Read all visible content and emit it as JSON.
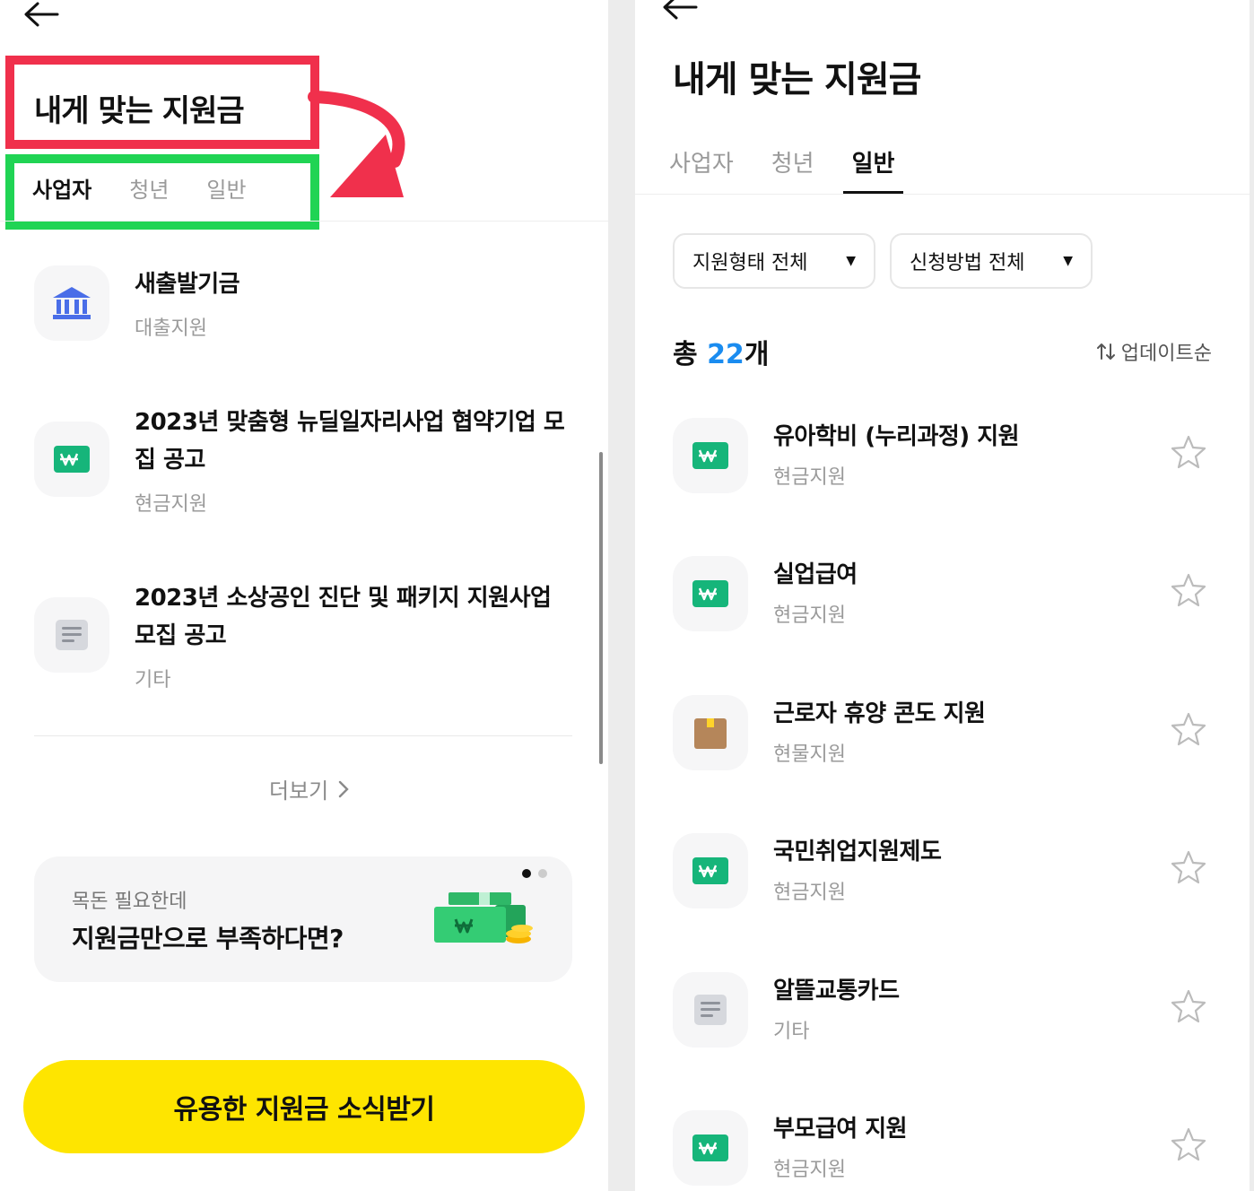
{
  "left": {
    "title": "내게 맞는 지원금",
    "tabs": [
      "사업자",
      "청년",
      "일반"
    ],
    "items": [
      {
        "title": "새출발기금",
        "category": "대출지원",
        "icon": "bank-icon"
      },
      {
        "title": "2023년 맞춤형 뉴딜일자리사업 협약기업 모집 공고",
        "category": "현금지원",
        "icon": "won-icon"
      },
      {
        "title": "2023년 소상공인 진단 및 패키지 지원사업 모집 공고",
        "category": "기타",
        "icon": "document-icon"
      }
    ],
    "more": "더보기",
    "banner": {
      "sub": "목돈 필요한데",
      "main": "지원금만으로 부족하다면?"
    },
    "cta": "유용한 지원금 소식받기"
  },
  "right": {
    "title": "내게 맞는 지원금",
    "tabs": [
      "사업자",
      "청년",
      "일반"
    ],
    "filters": [
      "지원형태 전체",
      "신청방법 전체"
    ],
    "count_prefix": "총",
    "count_num": "22",
    "count_suffix": "개",
    "sort": "업데이트순",
    "items": [
      {
        "title": "유아학비 (누리과정) 지원",
        "category": "현금지원",
        "icon": "won-icon"
      },
      {
        "title": "실업급여",
        "category": "현금지원",
        "icon": "won-icon"
      },
      {
        "title": "근로자 휴양 콘도 지원",
        "category": "현물지원",
        "icon": "box-icon"
      },
      {
        "title": "국민취업지원제도",
        "category": "현금지원",
        "icon": "won-icon"
      },
      {
        "title": "알뜰교통카드",
        "category": "기타",
        "icon": "document-icon"
      },
      {
        "title": "부모급여 지원",
        "category": "현금지원",
        "icon": "won-icon"
      }
    ]
  },
  "colors": {
    "accent_yellow": "#fee500",
    "won_green": "#16b57a",
    "annotation_red": "#f0304c",
    "annotation_green": "#20d454",
    "count_blue": "#1a8cf0"
  }
}
